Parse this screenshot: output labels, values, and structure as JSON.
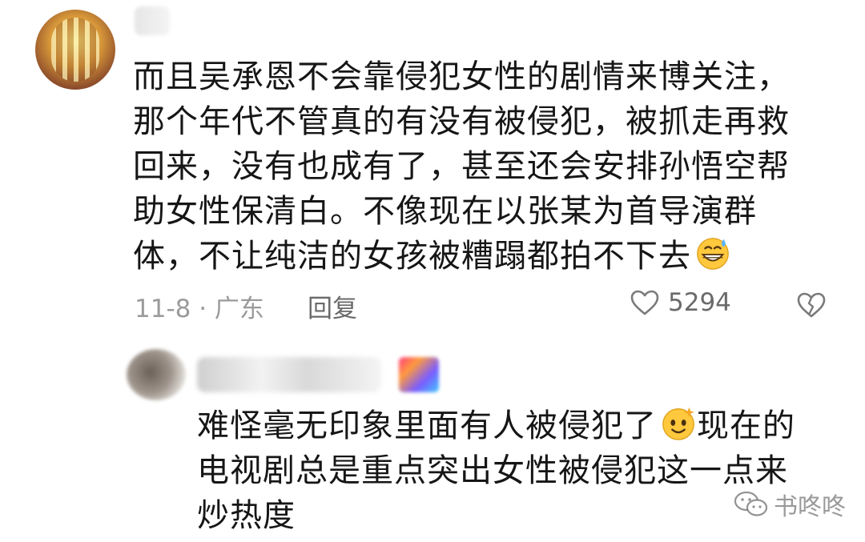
{
  "comment": {
    "text_lines": [
      "而且吴承恩不会靠侵犯女性的剧情来博关注，",
      "那个年代不管真的有没有被侵犯，被抓走再救",
      "回来，没有也成有了，甚至还会安排孙悟空帮",
      "助女性保清白。不像现在以张某为首导演群",
      "体，不让纯洁的女孩被糟蹋都拍不下去"
    ],
    "emoji": "grinning-sweat-face-icon",
    "date_location": "11-8 · 广东",
    "reply_label": "回复",
    "like_count": "5294"
  },
  "reply": {
    "text_lines": [
      "难怪毫无印象里面有人被侵犯了",
      "现在的",
      "电视剧总是重点突出女性被侵犯这一点来",
      "炒热度"
    ],
    "emoji": "dizzy-smile-face-icon"
  },
  "watermark": {
    "text": "书咚咚",
    "icon": "wechat-icon"
  },
  "colors": {
    "text": "#161616",
    "meta": "#9b9b9b",
    "emoji_face": "#ffc83d"
  }
}
